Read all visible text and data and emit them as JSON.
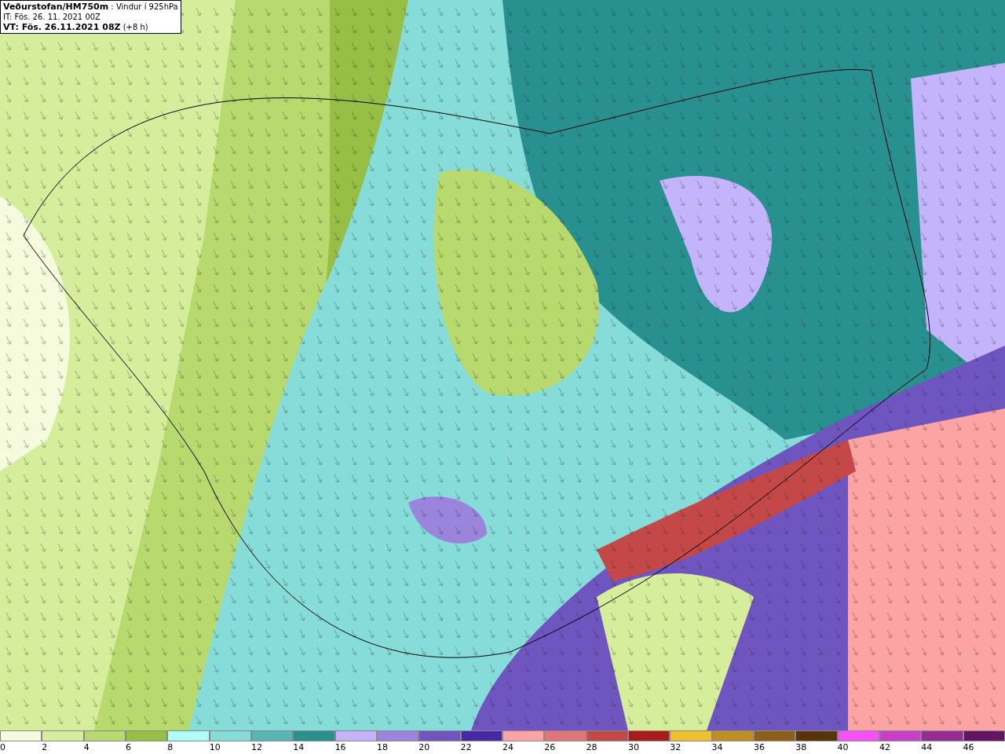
{
  "header": {
    "lines": [
      "**Veðurstofan/HM750m** : Vindur í 925hPa",
      "IT: Fös. 26. 11. 2021 00Z",
      "**VT: Fös. 26.11.2021 08Z** (+8 h)"
    ]
  },
  "legend": {
    "items": [
      {
        "color": "#f5fbdc",
        "label": "0"
      },
      {
        "color": "#d6ee9c",
        "label": "2"
      },
      {
        "color": "#b7d96e",
        "label": "4"
      },
      {
        "color": "#98bf45",
        "label": "6"
      },
      {
        "color": "#b0fcf8",
        "label": "8"
      },
      {
        "color": "#86dcd8",
        "label": "10"
      },
      {
        "color": "#56b6b4",
        "label": "12"
      },
      {
        "color": "#28918f",
        "label": "14"
      },
      {
        "color": "#c4b4fc",
        "label": "16"
      },
      {
        "color": "#9a84dc",
        "label": "18"
      },
      {
        "color": "#6e55c0",
        "label": "20"
      },
      {
        "color": "#4628a8",
        "label": "22"
      },
      {
        "color": "#fca4a4",
        "label": "24"
      },
      {
        "color": "#e07676",
        "label": "26"
      },
      {
        "color": "#c44848",
        "label": "28"
      },
      {
        "color": "#a81c1c",
        "label": "30"
      },
      {
        "color": "#f0c030",
        "label": "32"
      },
      {
        "color": "#bc9024",
        "label": "34"
      },
      {
        "color": "#8c6018",
        "label": "36"
      },
      {
        "color": "#58340c",
        "label": "38"
      },
      {
        "color": "#f850f8",
        "label": "40"
      },
      {
        "color": "#c840c8",
        "label": "42"
      },
      {
        "color": "#942c94",
        "label": "44"
      },
      {
        "color": "#641460",
        "label": "46"
      }
    ]
  }
}
